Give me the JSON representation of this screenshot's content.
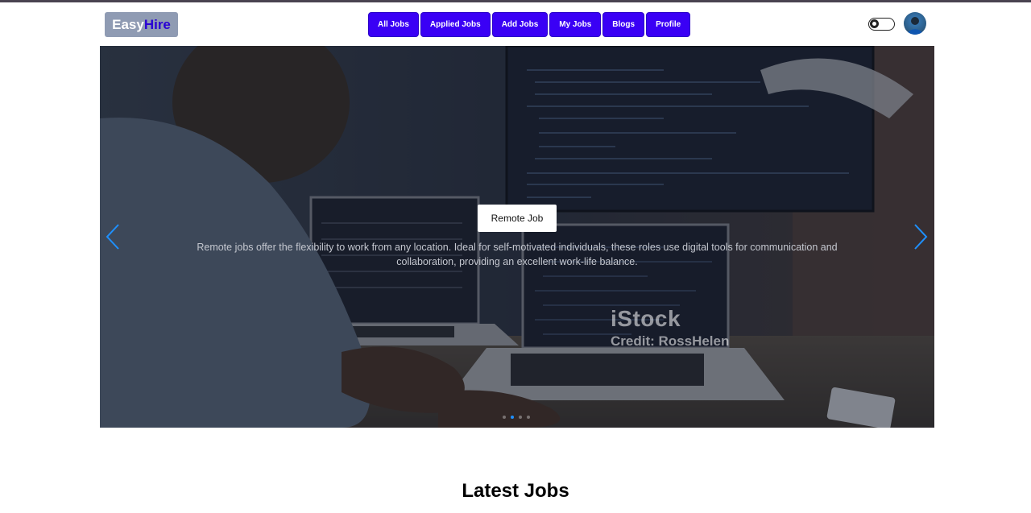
{
  "brand": {
    "part1": "Easy",
    "part2": "Hire",
    "part1_color": "#ffffff",
    "part2_color": "#2a00d4",
    "bg": "#8f9bb3"
  },
  "nav": {
    "accent": "#3a00f5",
    "items": [
      {
        "label": "All Jobs"
      },
      {
        "label": "Applied Jobs"
      },
      {
        "label": "Add Jobs"
      },
      {
        "label": "My Jobs"
      },
      {
        "label": "Blogs"
      },
      {
        "label": "Profile"
      }
    ]
  },
  "theme_toggle": {
    "icon": "theme-toggle-icon",
    "state": "off"
  },
  "user": {
    "icon": "avatar"
  },
  "carousel": {
    "slide": {
      "button_label": "Remote Job",
      "description": "Remote jobs offer the flexibility to work from any location. Ideal for self-motivated individuals, these roles use digital tools for communication and collaboration, providing an excellent work-life balance.",
      "watermark_brand": "iStock",
      "watermark_credit": "Credit: RossHelen"
    },
    "prev_icon": "chevron-left-icon",
    "next_icon": "chevron-right-icon",
    "indicator_count": 4,
    "active_index": 1,
    "arrow_color": "#1e90ff"
  },
  "section": {
    "title": "Latest Jobs"
  }
}
